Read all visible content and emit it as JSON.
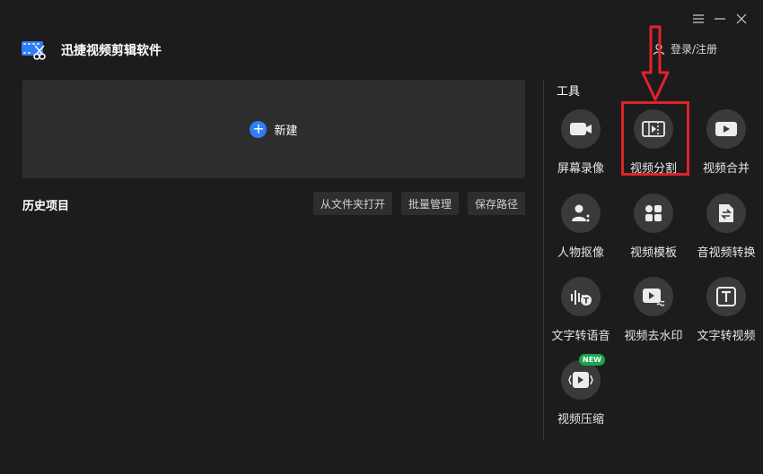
{
  "app": {
    "title": "迅捷视频剪辑软件"
  },
  "header": {
    "login_label": "登录/注册"
  },
  "window_controls": [
    "menu-icon",
    "minimize-icon",
    "close-icon"
  ],
  "main": {
    "new_label": "新建",
    "history_title": "历史项目",
    "history_buttons": [
      "从文件夹打开",
      "批量管理",
      "保存路径"
    ]
  },
  "tools": {
    "title": "工具",
    "items": [
      {
        "label": "屏幕录像",
        "icon": "camera-icon"
      },
      {
        "label": "视频分割",
        "icon": "film-split-icon"
      },
      {
        "label": "视频合并",
        "icon": "video-merge-icon"
      },
      {
        "label": "人物抠像",
        "icon": "person-cutout-icon"
      },
      {
        "label": "视频模板",
        "icon": "template-icon"
      },
      {
        "label": "音视频转换",
        "icon": "convert-icon"
      },
      {
        "label": "文字转语音",
        "icon": "text-to-speech-icon"
      },
      {
        "label": "视频去水印",
        "icon": "watermark-remove-icon"
      },
      {
        "label": "文字转视频",
        "icon": "text-to-video-icon"
      },
      {
        "label": "视频压缩",
        "icon": "compress-icon",
        "badge": "NEW"
      }
    ]
  },
  "colors": {
    "accent": "#2f7cf6",
    "highlight": "#e0232a",
    "badge": "#1aa550",
    "background": "#1c1c1c"
  }
}
